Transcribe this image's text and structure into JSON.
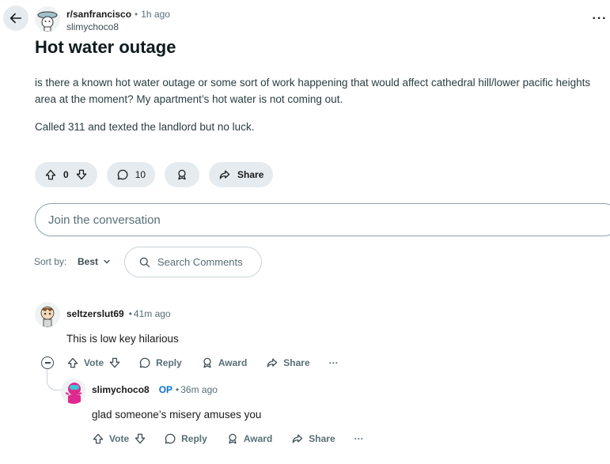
{
  "post": {
    "subreddit": "r/sanfrancisco",
    "time": "1h ago",
    "author": "slimychoco8",
    "title": "Hot water outage",
    "body": [
      "is there a known hot water outage or some sort of work happening that would affect cathedral hill/lower pacific heights area at the moment? My apartment’s hot water is not coming out.",
      "Called 311 and texted the landlord but no luck."
    ],
    "votes": "0",
    "comments": "10",
    "share_label": "Share",
    "more_label": "···"
  },
  "composer": {
    "placeholder": "Join the conversation"
  },
  "sort": {
    "label": "Sort by:",
    "value": "Best",
    "search_placeholder": "Search Comments"
  },
  "comments": [
    {
      "author": "seltzerslut69",
      "time": "41m ago",
      "text": "This is low key hilarious",
      "vote_label": "Vote",
      "reply_label": "Reply",
      "award_label": "Award",
      "share_label": "Share",
      "more_label": "···"
    },
    {
      "author": "slimychoco8",
      "op_badge": "OP",
      "time": "36m ago",
      "text": "glad someone’s misery amuses you",
      "vote_label": "Vote",
      "reply_label": "Reply",
      "award_label": "Award",
      "share_label": "Share",
      "more_label": "···"
    }
  ],
  "icons": {
    "back": "arrow-left-icon",
    "upvote": "arrow-up-icon",
    "downvote": "arrow-down-icon",
    "comment": "speech-bubble-icon",
    "award": "award-icon",
    "share": "share-arrow-icon",
    "search": "search-icon",
    "chevron": "chevron-down-icon",
    "collapse": "minus-circle-icon"
  },
  "colors": {
    "pill_bg": "#e5ebee",
    "op": "#0a6fd1",
    "text_muted": "#576f76"
  }
}
